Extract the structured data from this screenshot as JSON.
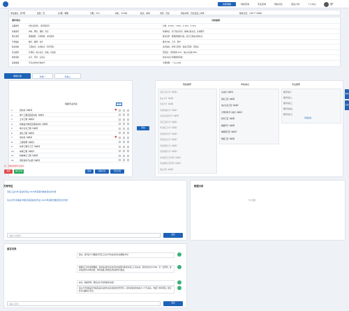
{
  "header": {
    "nav": [
      "志愿填报",
      "院校查询",
      "专业查询",
      "院校对比",
      "招生计划",
      "个人中心"
    ],
    "username": "张*"
  },
  "student": {
    "name": "学生姓名：张*明",
    "gender": "性别：男",
    "category": "文/理：物理",
    "score": "分数：532",
    "rank": "排名：31568",
    "batch": "批次：本科",
    "region": "省份：河北",
    "school": "所在中学：石家庄第二中学",
    "phone": "联系方式：138****8888"
  },
  "score_table": {
    "head_left": "测评项目",
    "head_right": "分析结果",
    "rows": [
      {
        "label": "兴趣类型",
        "value": "R型(实际型)、I型(研究型)",
        "detail": "分类：R 40%、I 30%、A 15%、S 15%"
      },
      {
        "label": "性格类型",
        "value": "内向、理性、谨慎、务实",
        "detail": "性格特点：善于独立思考，做事认真负责，注重细节"
      },
      {
        "label": "能力类型",
        "value": "逻辑推理、空间想象、动手操作",
        "detail": "能力优势：数理逻辑能力强，适合工程技术类专业"
      },
      {
        "label": "学科偏好",
        "value": "数学、物理、化学",
        "detail": "推荐方向：工学、理学"
      },
      {
        "label": "职业倾向",
        "value": "工程技术、信息技术、科学研究",
        "detail": "适合职业：软件工程师、机械工程师、研究员"
      },
      {
        "label": "专业推荐",
        "value": "计算机、电子信息、机械、自动化",
        "detail": "匹配度：计算机类 92%、电子信息类 88%"
      },
      {
        "label": "城市倾向",
        "value": "北京、天津、石家庄",
        "detail": "优先考虑京津冀地区院校"
      },
      {
        "label": "其他要求",
        "value": "不考虑中外合作办学",
        "detail": "学费预算：一万元以内"
      }
    ]
  },
  "tabs": [
    "填报方案",
    "方案一",
    "方案二"
  ],
  "wish_list": {
    "title": "填报专业列表",
    "clear_label": "清空",
    "items": [
      {
        "num": "1",
        "name": "自动化【本科】",
        "fav": "♥"
      },
      {
        "num": "2",
        "name": "电气工程及其自动化【本科】",
        "fav": ""
      },
      {
        "num": "3",
        "name": "土木工程【本科】",
        "fav": ""
      },
      {
        "num": "4",
        "name": "机械设计制造及其自动化【本科】",
        "fav": ""
      },
      {
        "num": "5",
        "name": "电子信息工程【本科】",
        "fav": ""
      },
      {
        "num": "6",
        "name": "通信工程【本科】",
        "fav": ""
      },
      {
        "num": "7",
        "name": "自动化【本科】",
        "fav": "♥"
      },
      {
        "num": "8",
        "name": "工程管理【本科】",
        "fav": ""
      },
      {
        "num": "9",
        "name": "化学工程与工艺【本科】",
        "fav": ""
      },
      {
        "num": "10",
        "name": "车辆工程【本科】",
        "fav": ""
      },
      {
        "num": "11",
        "name": "机械电子工程【本科】",
        "fav": ""
      },
      {
        "num": "12",
        "name": "测控技术与仪器【本科】",
        "fav": ""
      }
    ],
    "note": "注：可拖拽调整专业顺序",
    "buttons": {
      "reset": "重置",
      "save": "保存方案",
      "submit": "提交",
      "compare": "院校对比",
      "export": "导出方案"
    }
  },
  "add_button": "添加",
  "recommend": {
    "col_school": "院校推荐",
    "col_plan": "学校信息",
    "col_major": "专业推荐",
    "schools": [
      "河北工业大学【本科】",
      "燕山大学【本科】",
      "河北大学【本科】",
      "河北科技大学【本科】",
      "石家庄铁道大学【本科】",
      "河北工程大学【本科】",
      "华北理工大学【本科】",
      "河北师范大学【本科】",
      "河北农业大学【本科】",
      "河北经贸大学【本科】",
      "河北地质大学【本科】",
      "北华航天工业学院【本科】",
      "河北建筑工程学院【本科】",
      "唐山学院【本科】"
    ],
    "plans": [
      "自动化【本科】",
      "通信工程【本科】",
      "电子信息工程【本科】",
      "计算机科学与技术【本科】",
      "软件工程【本科】",
      "数据科学【本科】",
      "物联网工程【本科】",
      "网络工程【本科】"
    ],
    "majors": [
      "推荐专业一",
      "推荐专业二",
      "推荐专业三",
      "推荐专业四",
      "推荐专业五"
    ],
    "search_label": "查看更多"
  },
  "plan_section": {
    "title": "方案专区",
    "links": [
      "河北工业大学 自动化专业 2023年录取分数线及位次分析",
      "燕山大学 机械设计制造及其自动化专业 2023年录取分数线及位次分析"
    ],
    "input_placeholder": "请输入关键词",
    "send_label": "发送"
  },
  "analysis_section": {
    "title": "数据分析",
    "empty_text": "暂无数据"
  },
  "messages": {
    "title": "留言记录",
    "items": [
      {
        "text": "您好，请问这个分数报考河北工业大学的自动化专业把握大吗？"
      },
      {
        "text": "根据近三年的录取数据，该校自动化专业在河北的最低录取位次在三万名左右，您的位次为31568，有一定风险，建议将其作为冲刺志愿，同时填报几所稳妥的院校作为保底。"
      },
      {
        "text": "好的，谢谢老师，那燕山大学的机械专业呢？"
      },
      {
        "text": "燕山大学机械设计制造及其自动化专业是该校的优势学科，近年录取位次在两万八千名左右，也属于冲刺范围，建议结合兴趣综合考虑。"
      }
    ],
    "input_placeholder": "请输入留言",
    "send_label": "发送"
  },
  "side": [
    "客服",
    "反馈"
  ],
  "colors": {
    "primary": "#1e63b8",
    "danger": "#e04b4b",
    "success": "#2aa85a",
    "heart": "#d9363e"
  }
}
